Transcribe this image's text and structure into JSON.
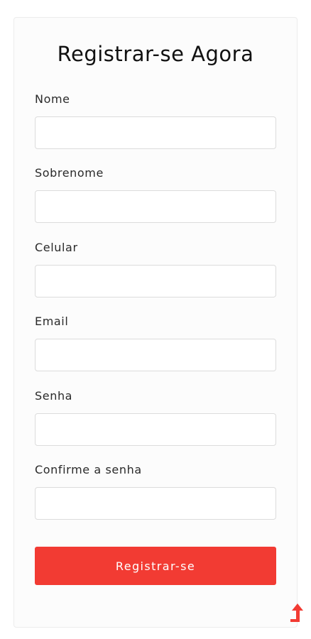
{
  "form": {
    "title": "Registrar-se Agora",
    "fields": [
      {
        "label": "Nome",
        "value": "",
        "placeholder": ""
      },
      {
        "label": "Sobrenome",
        "value": "",
        "placeholder": ""
      },
      {
        "label": "Celular",
        "value": "",
        "placeholder": ""
      },
      {
        "label": "Email",
        "value": "",
        "placeholder": ""
      },
      {
        "label": "Senha",
        "value": "",
        "placeholder": ""
      },
      {
        "label": "Confirme a senha",
        "value": "",
        "placeholder": ""
      }
    ],
    "submit_label": "Registrar-se"
  },
  "colors": {
    "accent": "#f23b33",
    "card_background": "#fcfcfc",
    "input_border": "#dcdcdc",
    "title_text": "#111111"
  },
  "icons": {
    "scroll_top": "arrow-up-icon"
  }
}
